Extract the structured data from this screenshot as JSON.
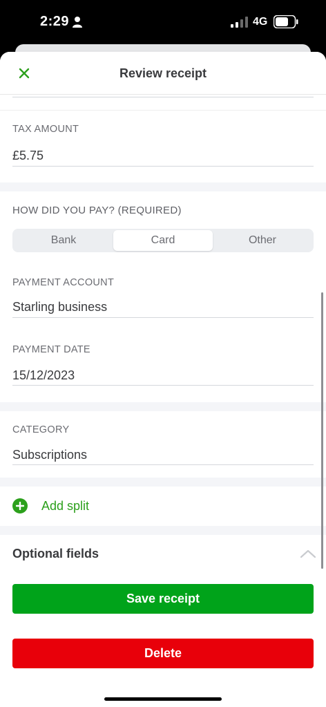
{
  "status_bar": {
    "time": "2:29",
    "network": "4G"
  },
  "header": {
    "title": "Review receipt"
  },
  "tax": {
    "label": "TAX AMOUNT",
    "value": "£5.75"
  },
  "payment_method": {
    "label": "HOW DID YOU PAY? (REQUIRED)",
    "options": [
      "Bank",
      "Card",
      "Other"
    ],
    "selected": "Card"
  },
  "payment_account": {
    "label": "PAYMENT ACCOUNT",
    "value": "Starling business"
  },
  "payment_date": {
    "label": "PAYMENT DATE",
    "value": "15/12/2023"
  },
  "category": {
    "label": "CATEGORY",
    "value": "Subscriptions"
  },
  "add_split": {
    "label": "Add split"
  },
  "optional": {
    "label": "Optional fields"
  },
  "actions": {
    "save_label": "Save receipt",
    "delete_label": "Delete"
  },
  "colors": {
    "accent_green": "#2ca01c",
    "save_green": "#00a31a",
    "delete_red": "#e8000a"
  },
  "icons": {
    "close": "close-icon",
    "add": "plus-circle-icon",
    "collapse": "chevron-up-icon",
    "person": "person-icon",
    "signal": "signal-icon",
    "battery": "battery-icon"
  }
}
